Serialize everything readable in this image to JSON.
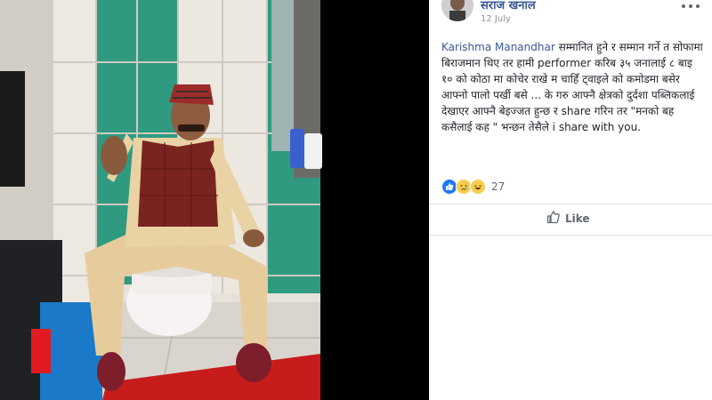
{
  "post": {
    "author": "सराज खनाल",
    "date": "12 July",
    "mention": "Karishma Manandhar",
    "body": " सम्मानित हुने र सम्मान गर्ने त सोफामा बिराजमान थिए तर हामी performer करिब ३५ जनालाई ८ बाइ १० को कोठा मा कोचेर राखे म चाहिँ ट्वाइले को कमोडमा बसेर आफ्नो पालो पर्खी बसे ... के गरु आफ्नै क्षेत्रको दुर्दशा पब्लिकलाई देखाएर आफ्नै बेइज्जत हुन्छ र share गरिन तर \"मनको बह कसैलाई कह \" भन्छन तेसैले i share with you."
  },
  "reactions": {
    "types": [
      "like",
      "sad",
      "haha"
    ],
    "count": "27"
  },
  "actions": {
    "like_label": "Like"
  },
  "icons": {
    "like": "thumbs-up-icon",
    "more": "more-options-icon"
  },
  "colors": {
    "link": "#385898",
    "like_blue": "#2078f4",
    "emoji_yellow": "#f7cd4a",
    "carpet_red": "#c81c1c",
    "tile_green": "#2f9a80"
  }
}
